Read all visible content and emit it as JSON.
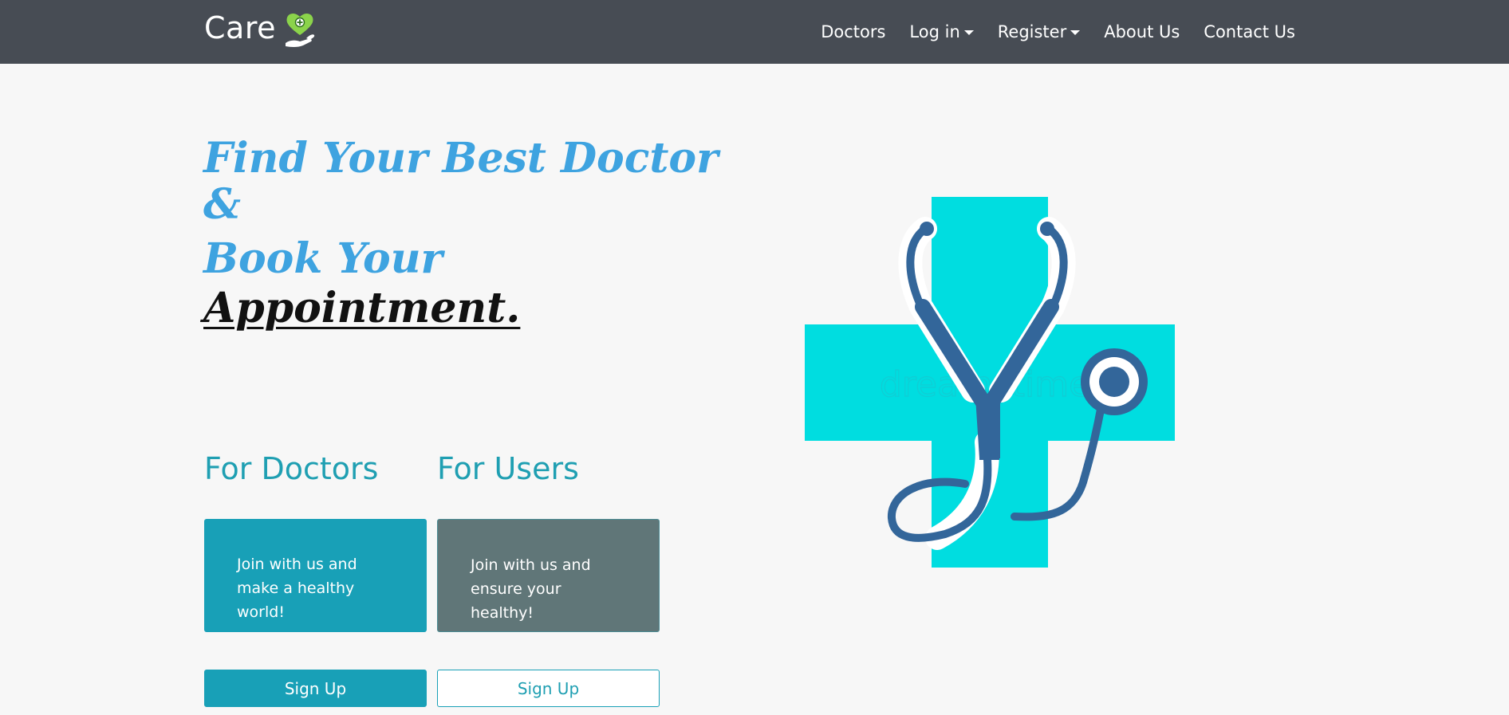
{
  "navbar": {
    "brand": "Care",
    "links": {
      "doctors": "Doctors",
      "login": "Log in",
      "register": "Register",
      "about": "About Us",
      "contact": "Contact Us"
    }
  },
  "hero": {
    "line1": "Find Your Best Doctor",
    "line2": "&",
    "line3": "Book Your",
    "line4": "Appointment."
  },
  "sections": {
    "doctors": {
      "title": "For Doctors",
      "card_text": "Join with us and make a healthy world!",
      "button": "Sign Up"
    },
    "users": {
      "title": "For Users",
      "card_text": "Join with us and ensure your healthy!",
      "button": "Sign Up"
    }
  },
  "illustration": {
    "icon": "medical-cross-stethoscope-icon",
    "watermark": "dreamstime"
  },
  "colors": {
    "navbar": "#474c54",
    "hero": "#3ea3e0",
    "accent": "#18a0b7",
    "users_card": "#607678",
    "cross": "#00dde0",
    "stethoscope": "#33669a",
    "logo_heart": "#8bd34b"
  }
}
